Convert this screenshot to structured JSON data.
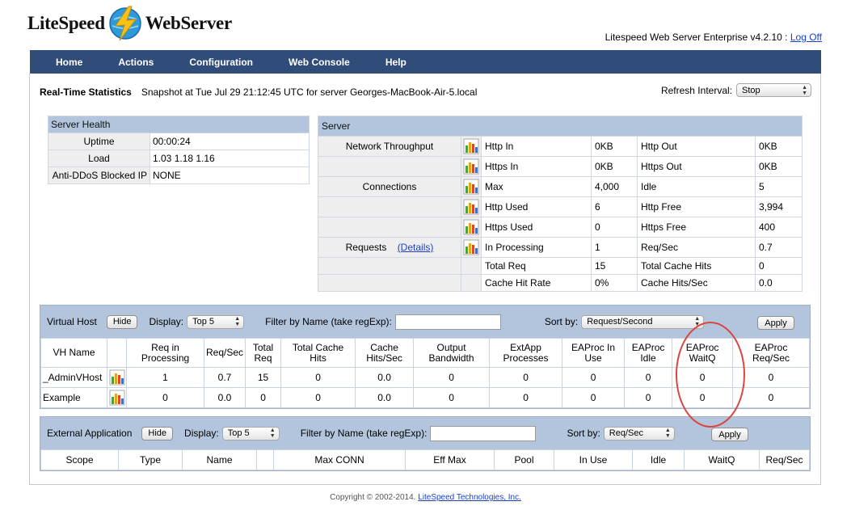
{
  "brand": {
    "logo_left": "LiteSpeed",
    "logo_right": "WebServer"
  },
  "header": {
    "version_text": "Litespeed Web Server Enterprise v4.2.10 :",
    "logoff_label": "Log Off"
  },
  "nav": [
    "Home",
    "Actions",
    "Configuration",
    "Web Console",
    "Help"
  ],
  "stats": {
    "title": "Real-Time Statistics",
    "snapshot": "Snapshot at Tue Jul 29 21:12:45 UTC for server Georges-MacBook-Air-5.local",
    "refresh_label": "Refresh Interval:",
    "refresh_value": "Stop"
  },
  "health": {
    "title": "Server Health",
    "rows": [
      {
        "label": "Uptime",
        "value": "00:00:24"
      },
      {
        "label": "Load",
        "value": "1.03 1.18 1.16"
      },
      {
        "label": "Anti-DDoS Blocked IP",
        "value": "NONE"
      }
    ]
  },
  "server": {
    "title": "Server",
    "network_label": "Network Throughput",
    "connections_label": "Connections",
    "requests_label": "Requests",
    "details_label": "(Details)",
    "rows": [
      {
        "k1": "Http In",
        "v1": "0KB",
        "k2": "Http Out",
        "v2": "0KB"
      },
      {
        "k1": "Https In",
        "v1": "0KB",
        "k2": "Https Out",
        "v2": "0KB"
      },
      {
        "k1": "Max",
        "v1": "4,000",
        "k2": "Idle",
        "v2": "5"
      },
      {
        "k1": "Http Used",
        "v1": "6",
        "k2": "Http Free",
        "v2": "3,994"
      },
      {
        "k1": "Https Used",
        "v1": "0",
        "k2": "Https Free",
        "v2": "400"
      },
      {
        "k1": "In Processing",
        "v1": "1",
        "k2": "Req/Sec",
        "v2": "0.7"
      },
      {
        "k1": "Total Req",
        "v1": "15",
        "k2": "Total Cache Hits",
        "v2": "0"
      },
      {
        "k1": "Cache Hit Rate",
        "v1": "0%",
        "k2": "Cache Hits/Sec",
        "v2": "0.0"
      }
    ]
  },
  "vhost": {
    "title": "Virtual Host",
    "hide_label": "Hide",
    "display_label": "Display:",
    "display_value": "Top 5",
    "filter_label": "Filter by Name (take regExp):",
    "filter_value": "",
    "sort_label": "Sort by:",
    "sort_value": "Request/Second",
    "apply_label": "Apply",
    "columns": [
      [
        "VH Name",
        ""
      ],
      [
        "",
        ""
      ],
      [
        "Req in",
        "Processing"
      ],
      [
        "Req/Sec",
        ""
      ],
      [
        "Total",
        "Req"
      ],
      [
        "Total Cache",
        "Hits"
      ],
      [
        "Cache",
        "Hits/Sec"
      ],
      [
        "Output",
        "Bandwidth"
      ],
      [
        "ExtApp",
        "Processes"
      ],
      [
        "EAProc In",
        "Use"
      ],
      [
        "EAProc",
        "Idle"
      ],
      [
        "EAProc",
        "WaitQ"
      ],
      [
        "EAProc",
        "Req/Sec"
      ]
    ],
    "rows": [
      {
        "name": "_AdminVHost",
        "cells": [
          "1",
          "0.7",
          "15",
          "0",
          "0.0",
          "0",
          "0",
          "0",
          "0",
          "0",
          "0"
        ]
      },
      {
        "name": "Example",
        "cells": [
          "0",
          "0.0",
          "0",
          "0",
          "0.0",
          "0",
          "0",
          "0",
          "0",
          "0",
          "0"
        ]
      }
    ]
  },
  "extapp": {
    "title": "External Application",
    "hide_label": "Hide",
    "display_label": "Display:",
    "display_value": "Top 5",
    "filter_label": "Filter by Name (take regExp):",
    "filter_value": "",
    "sort_label": "Sort by:",
    "sort_value": "Req/Sec",
    "apply_label": "Apply",
    "columns": [
      "Scope",
      "Type",
      "Name",
      "",
      "Max CONN",
      "Eff Max",
      "Pool",
      "In Use",
      "Idle",
      "WaitQ",
      "Req/Sec"
    ]
  },
  "footer": {
    "copyright": "Copyright © 2002-2014.",
    "company": "LiteSpeed Technologies, Inc."
  },
  "icons": {
    "logo": "lightning-globe-icon",
    "chart": "bar-chart-icon",
    "select": "updown-arrow-icon"
  },
  "colors": {
    "nav_bg": "#2f4d78",
    "table_header": "#b3c5dd",
    "highlight_circle": "#d9463f"
  }
}
